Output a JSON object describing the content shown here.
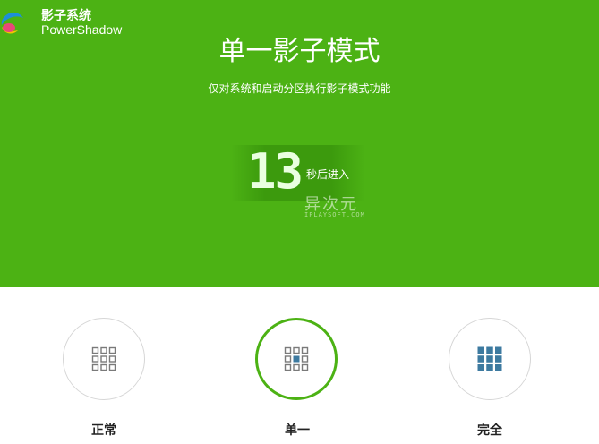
{
  "app": {
    "name_cn": "影子系统",
    "name_en": "PowerShadow",
    "logo_icon": "powershadow-logo-icon"
  },
  "main": {
    "title": "单一影子模式",
    "subtitle": "仅对系统和启动分区执行影子模式功能"
  },
  "countdown": {
    "value": "13",
    "suffix": "秒后进入"
  },
  "watermark": {
    "line1": "异次元",
    "line2": "IPLAYSOFT.COM"
  },
  "modes": [
    {
      "label": "正常",
      "icon": "grid-outline-icon",
      "selected": false
    },
    {
      "label": "单一",
      "icon": "grid-center-filled-icon",
      "selected": true
    },
    {
      "label": "完全",
      "icon": "grid-filled-icon",
      "selected": false
    }
  ],
  "colors": {
    "accent": "#4cb214",
    "tile": "#3d7aa0",
    "outline": "#7a7a7a"
  }
}
